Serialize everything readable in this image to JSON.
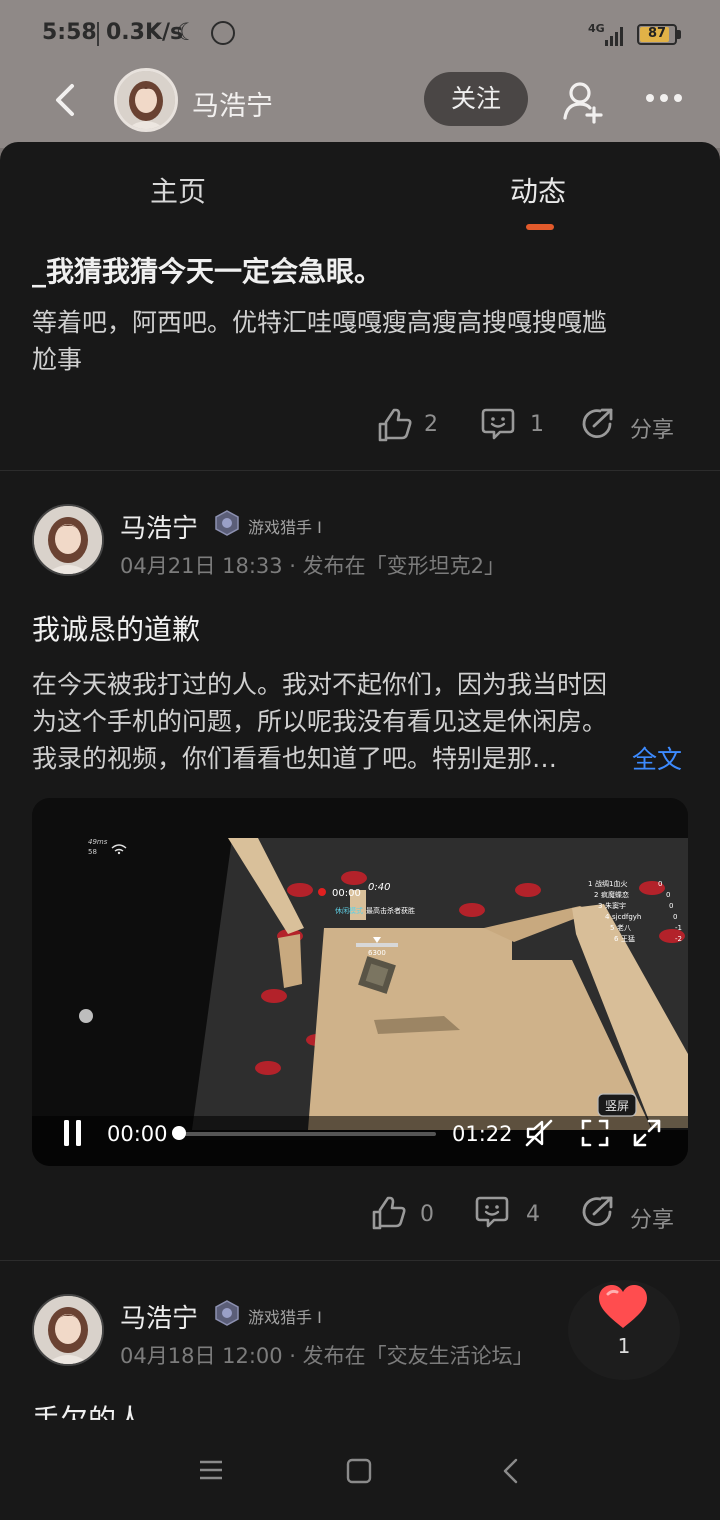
{
  "status_bar": {
    "time": "5:58",
    "speed": "0.3K/s",
    "network": "4G",
    "battery": "87"
  },
  "header": {
    "name": "马浩宁",
    "follow_label": "关注"
  },
  "tabs": [
    {
      "label": "主页"
    },
    {
      "label": "动态"
    }
  ],
  "posts": [
    {
      "title": "_我猜我猜今天一定会急眼。",
      "body_line1": "等着吧，阿西吧。优特汇哇嘎嘎瘦高瘦高搜嘎搜嘎尴",
      "body_line2": "尬事",
      "likes": "2",
      "comments": "1",
      "share": "分享"
    },
    {
      "author": "马浩宁",
      "badge": "游戏猎手 Ⅰ",
      "meta": "04月21日 18:33 · 发布在「变形坦克2」",
      "title": "我诚恳的道歉",
      "body_line1": "在今天被我打过的人。我对不起你们，因为我当时因",
      "body_line2": "为这个手机的问题，所以呢我没有看见这是休闲房。",
      "body_line3": "我录的视频，你们看看也知道了吧。特别是那…",
      "full_text": "全文",
      "video": {
        "current_time": "00:00",
        "duration": "01:22",
        "portrait_label": "竖屏",
        "hud_ping": "49ms",
        "hud_fps": "58",
        "hud_timer": "00:00",
        "hud_countdown": "0:40",
        "hud_mode": "休闲模式",
        "hud_mode_desc": "最高击杀者获胜",
        "hud_hp": "6300",
        "scoreboard": [
          {
            "rank": "1",
            "name": "战绸1血火",
            "score": "0"
          },
          {
            "rank": "2",
            "name": "疯魔蝶恋",
            "score": "0"
          },
          {
            "rank": "3",
            "name": "朱窦宇",
            "score": "0"
          },
          {
            "rank": "4",
            "name": "sjcdfgyh",
            "score": "0"
          },
          {
            "rank": "5",
            "name": "老八",
            "score": "-1"
          },
          {
            "rank": "6",
            "name": "王猛",
            "score": "-2"
          }
        ]
      },
      "likes": "0",
      "comments": "4",
      "share": "分享"
    },
    {
      "author": "马浩宁",
      "badge": "游戏猎手 Ⅰ",
      "meta": "04月18日 12:00 · 发布在「交友生活论坛」",
      "title": "手欠的人。"
    }
  ],
  "floating_like": {
    "count": "1"
  },
  "colors": {
    "accent": "#e25a2b",
    "link": "#3d8bff",
    "heart": "#ff4d4f"
  }
}
